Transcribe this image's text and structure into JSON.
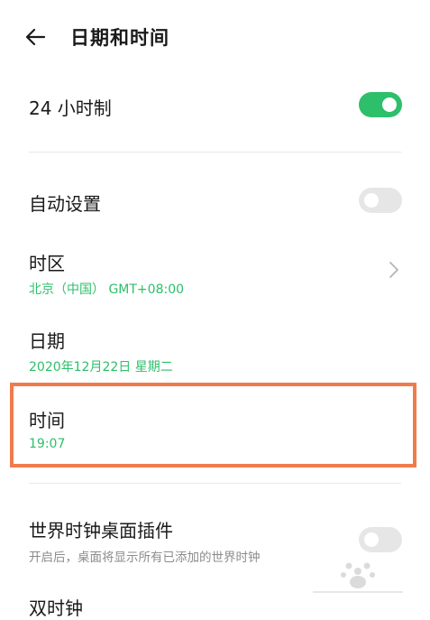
{
  "header": {
    "title": "日期和时间"
  },
  "settings": {
    "hour24": {
      "label": "24 小时制",
      "enabled": true
    },
    "auto": {
      "label": "自动设置",
      "enabled": false
    },
    "timezone": {
      "label": "时区",
      "value": "北京（中国） GMT+08:00"
    },
    "date": {
      "label": "日期",
      "value": "2020年12月22日 星期二"
    },
    "time": {
      "label": "时间",
      "value": "19:07"
    },
    "world_clock": {
      "label": "世界时钟桌面插件",
      "description": "开启后，桌面将显示所有已添加的世界时钟",
      "enabled": false
    },
    "dual_clock": {
      "label": "双时钟"
    }
  },
  "colors": {
    "accent": "#2dbf6a",
    "highlight": "#f07b4b",
    "divider": "#e8e8e8"
  }
}
